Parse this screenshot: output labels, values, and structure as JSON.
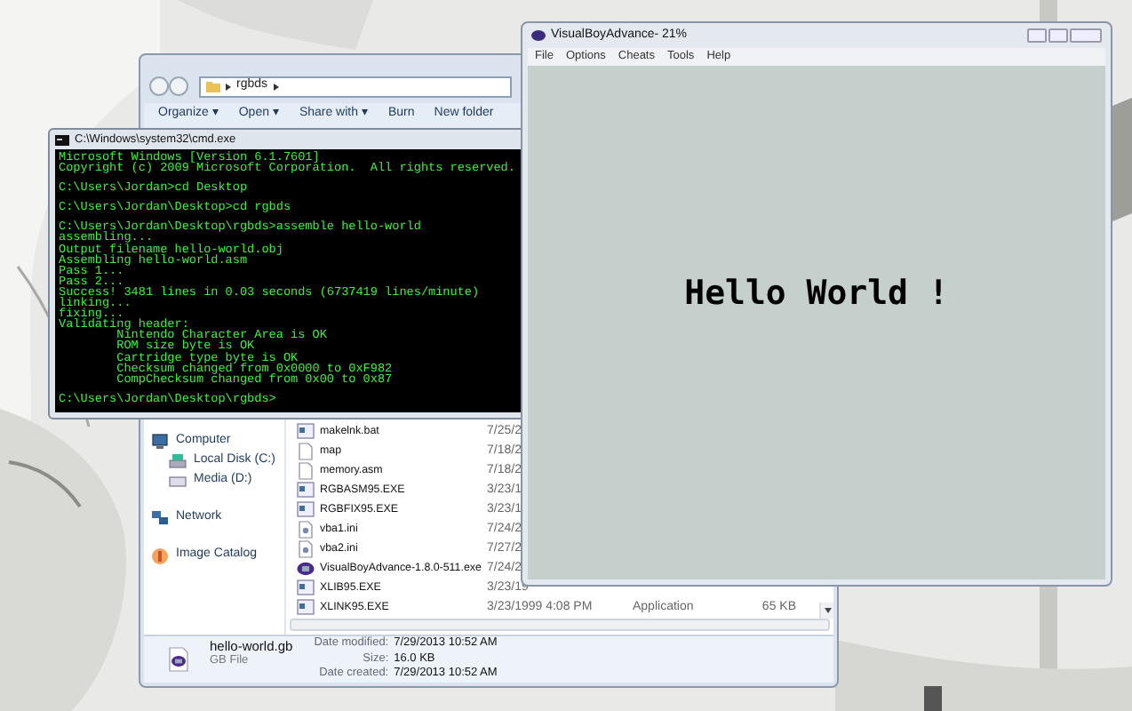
{
  "explorer": {
    "breadcrumb": [
      "rgbds"
    ],
    "toolbar": [
      "Organize ▾",
      "Open ▾",
      "Share with ▾",
      "Burn",
      "New folder"
    ],
    "nav": [
      {
        "label": "Computer",
        "kind": "computer",
        "children": [
          {
            "label": "Local Disk (C:)",
            "kind": "disk"
          },
          {
            "label": "Media (D:)",
            "kind": "drive"
          }
        ]
      },
      {
        "label": "Network",
        "kind": "network"
      },
      {
        "label": "Image Catalog",
        "kind": "catalog"
      }
    ],
    "files": [
      {
        "name": "makelnk.bat",
        "kind": "batch",
        "date": "7/25/2"
      },
      {
        "name": "map",
        "kind": "doc",
        "date": "7/18/2"
      },
      {
        "name": "memory.asm",
        "kind": "doc",
        "date": "7/18/2"
      },
      {
        "name": "RGBASM95.EXE",
        "kind": "exe",
        "date": "3/23/1"
      },
      {
        "name": "RGBFIX95.EXE",
        "kind": "exe",
        "date": "3/23/1"
      },
      {
        "name": "vba1.ini",
        "kind": "ini",
        "date": "7/24/2"
      },
      {
        "name": "vba2.ini",
        "kind": "ini",
        "date": "7/27/2"
      },
      {
        "name": "VisualBoyAdvance-1.8.0-511.exe",
        "kind": "app",
        "date": "7/24/2"
      },
      {
        "name": "XLIB95.EXE",
        "kind": "exe",
        "date": "3/23/19"
      },
      {
        "name": "XLINK95.EXE",
        "kind": "exe",
        "date": "3/23/1999 4:08 PM",
        "type": "Application",
        "size": "65 KB"
      }
    ],
    "details": {
      "name": "hello-world.gb",
      "type": "GB File",
      "fields": [
        {
          "label": "Date modified:",
          "value": "7/29/2013 10:52 AM"
        },
        {
          "label": "Size:",
          "value": "16.0 KB"
        },
        {
          "label": "Date created:",
          "value": "7/29/2013 10:52 AM"
        }
      ]
    }
  },
  "cmd": {
    "title": "C:\\Windows\\system32\\cmd.exe",
    "blocks": [
      [
        "Microsoft Windows [Version 6.1.7601]",
        "Copyright (c) 2009 Microsoft Corporation.  All rights reserved."
      ],
      [
        "C:\\Users\\Jordan>cd Desktop"
      ],
      [
        "C:\\Users\\Jordan\\Desktop>cd rgbds"
      ],
      [
        "C:\\Users\\Jordan\\Desktop\\rgbds>assemble hello-world",
        "assembling...",
        "Output filename hello-world.obj",
        "Assembling hello-world.asm",
        "Pass 1...",
        "Pass 2...",
        "Success! 3481 lines in 0.03 seconds (6737419 lines/minute)",
        "linking...",
        "fixing...",
        "Validating header:",
        "        Nintendo Character Area is OK",
        "        ROM size byte is OK",
        "        Cartridge type byte is OK",
        "        Checksum changed from 0x0000 to 0xF982",
        "        CompChecksum changed from 0x00 to 0x87"
      ],
      [
        "C:\\Users\\Jordan\\Desktop\\rgbds>"
      ]
    ]
  },
  "vba": {
    "title": "VisualBoyAdvance- 21%",
    "menu": [
      "File",
      "Options",
      "Cheats",
      "Tools",
      "Help"
    ],
    "screen_text": "Hello World !"
  }
}
